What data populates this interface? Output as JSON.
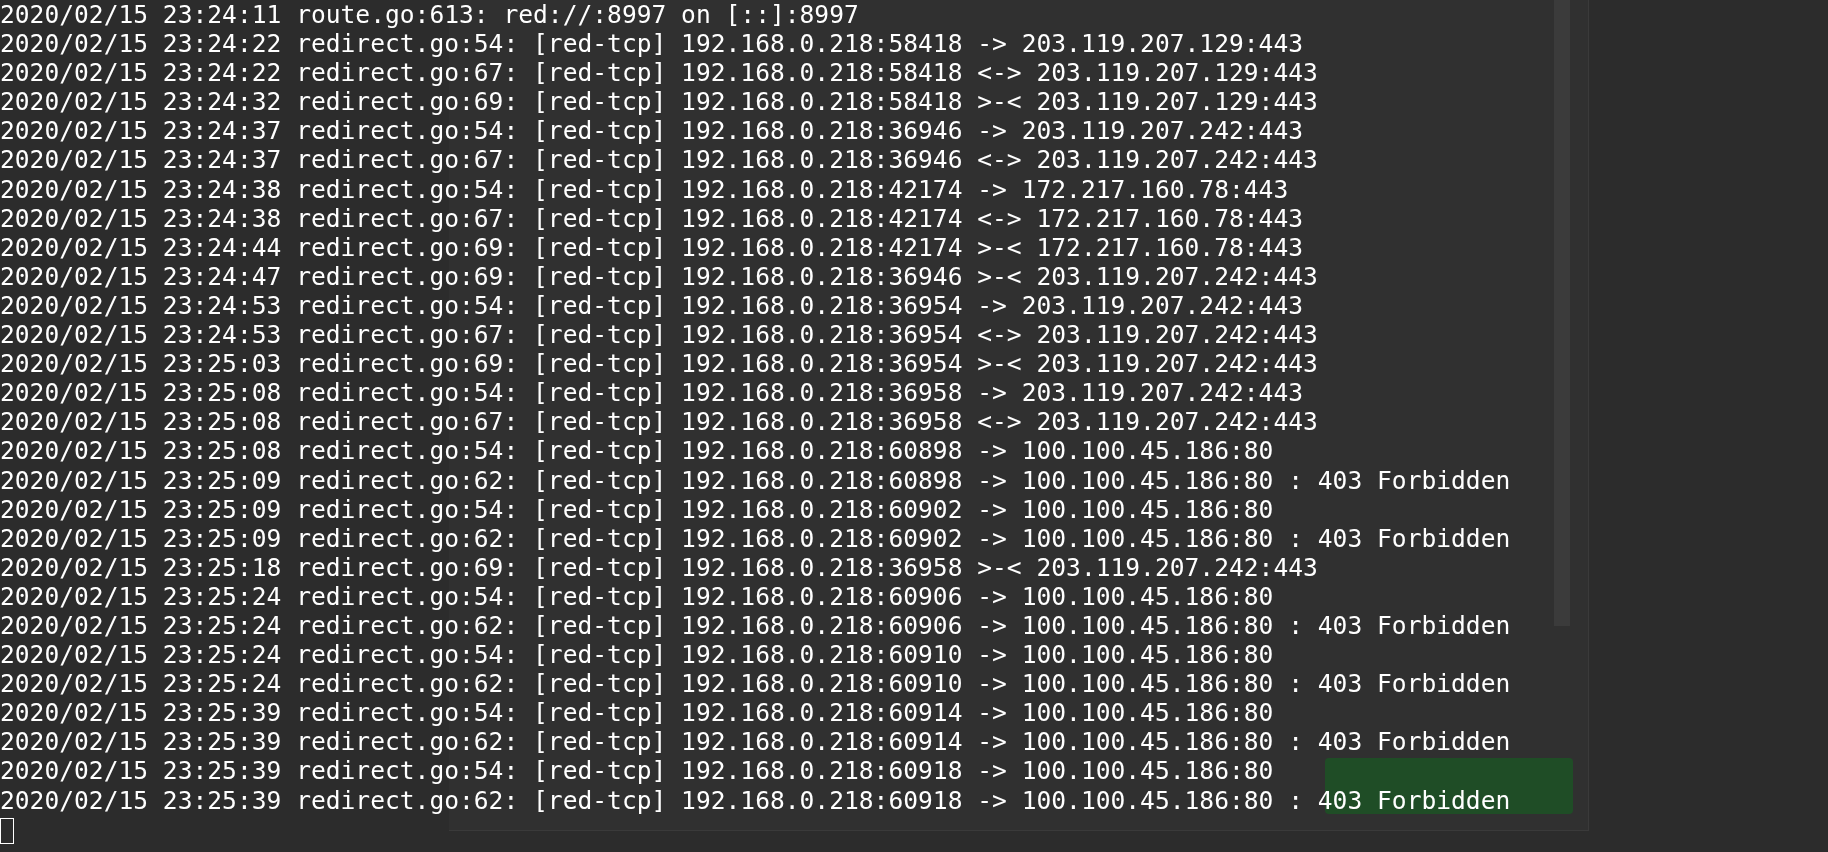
{
  "terminal": {
    "lines": [
      "2020/02/15 23:24:11 route.go:613: red://:8997 on [::]:8997",
      "2020/02/15 23:24:22 redirect.go:54: [red-tcp] 192.168.0.218:58418 -> 203.119.207.129:443",
      "2020/02/15 23:24:22 redirect.go:67: [red-tcp] 192.168.0.218:58418 <-> 203.119.207.129:443",
      "2020/02/15 23:24:32 redirect.go:69: [red-tcp] 192.168.0.218:58418 >-< 203.119.207.129:443",
      "2020/02/15 23:24:37 redirect.go:54: [red-tcp] 192.168.0.218:36946 -> 203.119.207.242:443",
      "2020/02/15 23:24:37 redirect.go:67: [red-tcp] 192.168.0.218:36946 <-> 203.119.207.242:443",
      "2020/02/15 23:24:38 redirect.go:54: [red-tcp] 192.168.0.218:42174 -> 172.217.160.78:443",
      "2020/02/15 23:24:38 redirect.go:67: [red-tcp] 192.168.0.218:42174 <-> 172.217.160.78:443",
      "2020/02/15 23:24:44 redirect.go:69: [red-tcp] 192.168.0.218:42174 >-< 172.217.160.78:443",
      "2020/02/15 23:24:47 redirect.go:69: [red-tcp] 192.168.0.218:36946 >-< 203.119.207.242:443",
      "2020/02/15 23:24:53 redirect.go:54: [red-tcp] 192.168.0.218:36954 -> 203.119.207.242:443",
      "2020/02/15 23:24:53 redirect.go:67: [red-tcp] 192.168.0.218:36954 <-> 203.119.207.242:443",
      "2020/02/15 23:25:03 redirect.go:69: [red-tcp] 192.168.0.218:36954 >-< 203.119.207.242:443",
      "2020/02/15 23:25:08 redirect.go:54: [red-tcp] 192.168.0.218:36958 -> 203.119.207.242:443",
      "2020/02/15 23:25:08 redirect.go:67: [red-tcp] 192.168.0.218:36958 <-> 203.119.207.242:443",
      "2020/02/15 23:25:08 redirect.go:54: [red-tcp] 192.168.0.218:60898 -> 100.100.45.186:80",
      "2020/02/15 23:25:09 redirect.go:62: [red-tcp] 192.168.0.218:60898 -> 100.100.45.186:80 : 403 Forbidden",
      "2020/02/15 23:25:09 redirect.go:54: [red-tcp] 192.168.0.218:60902 -> 100.100.45.186:80",
      "2020/02/15 23:25:09 redirect.go:62: [red-tcp] 192.168.0.218:60902 -> 100.100.45.186:80 : 403 Forbidden",
      "2020/02/15 23:25:18 redirect.go:69: [red-tcp] 192.168.0.218:36958 >-< 203.119.207.242:443",
      "2020/02/15 23:25:24 redirect.go:54: [red-tcp] 192.168.0.218:60906 -> 100.100.45.186:80",
      "2020/02/15 23:25:24 redirect.go:62: [red-tcp] 192.168.0.218:60906 -> 100.100.45.186:80 : 403 Forbidden",
      "2020/02/15 23:25:24 redirect.go:54: [red-tcp] 192.168.0.218:60910 -> 100.100.45.186:80",
      "2020/02/15 23:25:24 redirect.go:62: [red-tcp] 192.168.0.218:60910 -> 100.100.45.186:80 : 403 Forbidden",
      "2020/02/15 23:25:39 redirect.go:54: [red-tcp] 192.168.0.218:60914 -> 100.100.45.186:80",
      "2020/02/15 23:25:39 redirect.go:62: [red-tcp] 192.168.0.218:60914 -> 100.100.45.186:80 : 403 Forbidden",
      "2020/02/15 23:25:39 redirect.go:54: [red-tcp] 192.168.0.218:60918 -> 100.100.45.186:80",
      "2020/02/15 23:25:39 redirect.go:62: [red-tcp] 192.168.0.218:60918 -> 100.100.45.186:80 : 403 Forbidden"
    ]
  }
}
